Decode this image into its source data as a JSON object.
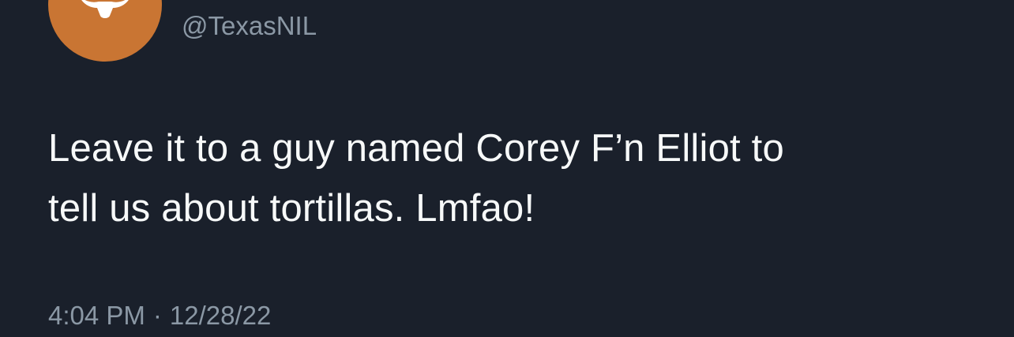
{
  "tweet": {
    "handle": "@TexasNIL",
    "text_line1": "Leave it to a guy named Corey F’n Elliot to",
    "text_line2": "tell us about tortillas. Lmfao!",
    "time": "4:04 PM",
    "separator": "·",
    "date": "12/28/22"
  },
  "avatar": {
    "icon": "longhorn-icon",
    "background_color": "#c97533"
  },
  "colors": {
    "background": "#1a202b",
    "primary_text": "#f7f9f9",
    "secondary_text": "#8b98a5"
  }
}
